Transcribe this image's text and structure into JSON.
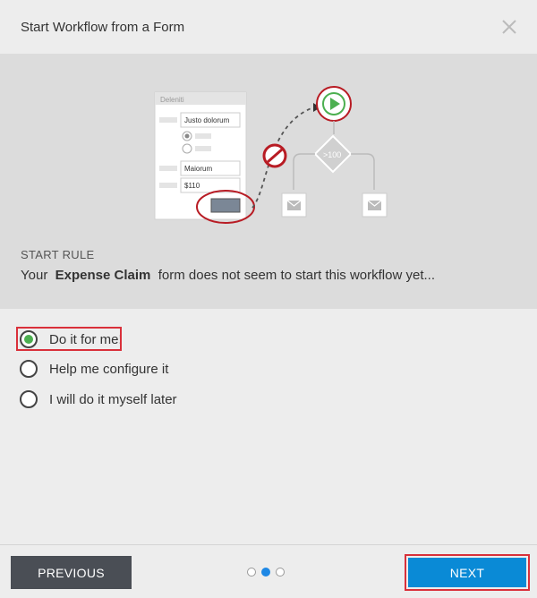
{
  "dialog": {
    "title": "Start Workflow from a Form",
    "close_icon": "close-icon"
  },
  "illustration": {
    "form_title": "Deleniti",
    "field1": "Justo dolorum",
    "field2": "Maiorum",
    "field3": "$110",
    "condition": ">100",
    "colors": {
      "accent_red": "#b81c24",
      "play_green": "#4caf50"
    }
  },
  "start_rule": {
    "label": "START RULE",
    "text_prefix": "Your",
    "form_name": "Expense Claim",
    "text_suffix": "form does not seem to start this workflow yet..."
  },
  "options": [
    {
      "label": "Do it for me!",
      "selected": true
    },
    {
      "label": "Help me configure it",
      "selected": false
    },
    {
      "label": "I will do it myself later",
      "selected": false
    }
  ],
  "footer": {
    "previous_label": "PREVIOUS",
    "next_label": "NEXT",
    "pages": 3,
    "current_page": 2,
    "colors": {
      "primary": "#0a8ad6",
      "secondary": "#4a4e55",
      "highlight": "#d9303a"
    }
  }
}
